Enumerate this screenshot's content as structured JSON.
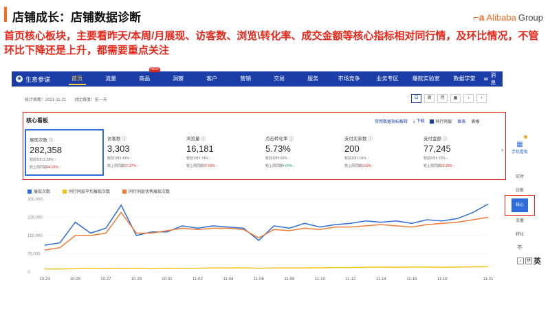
{
  "slide": {
    "title": "店铺成长：店铺数据诊断",
    "logo_mark": "⌐a",
    "logo_text": "Alibaba",
    "logo_group": "Group",
    "description": "首页核心板块，主要看昨天/本周/月展现、访客数、浏览\\转化率、成交金额等核心指标相对同行情，及环比情况，不管环比下降还是上升，都需要重点关注"
  },
  "nav": {
    "brand": "生意参谋",
    "items": [
      {
        "label": "首页",
        "active": true
      },
      {
        "label": "流量"
      },
      {
        "label": "商品",
        "badge": "NEW"
      },
      {
        "label": "洞察"
      },
      {
        "label": "客户"
      },
      {
        "label": "营销"
      },
      {
        "label": "交易"
      },
      {
        "label": "服务"
      },
      {
        "label": "市场竞争"
      },
      {
        "label": "业务专区"
      },
      {
        "label": "爆款实验室"
      },
      {
        "label": "数据学堂"
      }
    ],
    "message": "消息"
  },
  "stats": {
    "period_label": "统计周期：2021-11-21",
    "compare_label": "对比维度：前一天"
  },
  "range_buttons": [
    "日",
    "周",
    "月",
    "▦",
    "‹",
    "›"
  ],
  "core": {
    "title": "核心看板",
    "tool_explain": "常用数据指标解释",
    "tool_download": "下载",
    "tool_peer": "同行同层",
    "tool_chart": "图表",
    "tool_table": "表格",
    "metrics": [
      {
        "label": "展现次数",
        "value": "282,358",
        "day_label": "较前1日",
        "day_pct": "12.28%",
        "day_dir": "up",
        "week_label": "较上周同期",
        "week_pct": "44.03%",
        "week_dir": "up"
      },
      {
        "label": "访客数",
        "value": "3,303",
        "day_label": "较前1日",
        "day_pct": "3.41%",
        "day_dir": "up",
        "week_label": "较上周同期",
        "week_pct": "37.37%",
        "week_dir": "up"
      },
      {
        "label": "浏览量",
        "value": "16,181",
        "day_label": "较前1日",
        "day_pct": "5.74%",
        "day_dir": "up",
        "week_label": "较上周同期",
        "week_pct": "37.69%",
        "week_dir": "up"
      },
      {
        "label": "点击转化率",
        "value": "5.73%",
        "day_label": "较前1日",
        "day_pct": "5.82%",
        "day_dir": "down",
        "week_label": "较上周同期",
        "week_pct": "4.60%",
        "week_dir": "down"
      },
      {
        "label": "支付买家数",
        "value": "200",
        "day_label": "较前1日",
        "day_pct": "1.01%",
        "day_dir": "up",
        "week_label": "较上周同期",
        "week_pct": "3.63%",
        "week_dir": "up"
      },
      {
        "label": "支付金额",
        "value": "77,245",
        "day_label": "较前1日",
        "day_pct": "6.72%",
        "day_dir": "down",
        "week_label": "较上周同期",
        "week_pct": "19.29%",
        "week_dir": "up"
      }
    ]
  },
  "chart_data": {
    "type": "line",
    "x": [
      "10-23",
      "10-24",
      "10-25",
      "10-26",
      "10-27",
      "10-28",
      "10-29",
      "10-30",
      "10-31",
      "11-01",
      "11-02",
      "11-03",
      "11-04",
      "11-05",
      "11-06",
      "11-07",
      "11-08",
      "11-09",
      "11-10",
      "11-11",
      "11-12",
      "11-13",
      "11-14",
      "11-15",
      "11-16",
      "11-17",
      "11-18",
      "11-19",
      "11-20",
      "11-21"
    ],
    "xticks": [
      "10-23",
      "10-25",
      "10-27",
      "10-29",
      "10-31",
      "11-02",
      "11-04",
      "11-06",
      "11-08",
      "11-10",
      "11-12",
      "11-14",
      "11-16",
      "11-18",
      "11-21"
    ],
    "yticks": [
      "300,000",
      "225,000",
      "150,000",
      "75,000",
      "0"
    ],
    "ylim": [
      0,
      300000
    ],
    "series": [
      {
        "name": "展现次数",
        "color": "#2f6cdb",
        "values": [
          110000,
          120000,
          205000,
          160000,
          180000,
          275000,
          150000,
          165000,
          165000,
          190000,
          180000,
          190000,
          185000,
          180000,
          130000,
          190000,
          180000,
          200000,
          185000,
          195000,
          200000,
          210000,
          205000,
          210000,
          200000,
          215000,
          210000,
          220000,
          245000,
          280000
        ]
      },
      {
        "name": "同行同层平均展现次数",
        "color": "#f5c518",
        "values": [
          12000,
          12000,
          13000,
          14000,
          13000,
          15000,
          14000,
          13000,
          14000,
          15000,
          15000,
          16000,
          16000,
          17000,
          15000,
          16000,
          16000,
          16000,
          17000,
          18000,
          18000,
          19000,
          20000,
          19000,
          20000,
          20000,
          19000,
          20000,
          21000,
          22000
        ]
      },
      {
        "name": "同行同层优秀展现次数",
        "color": "#f07c37",
        "values": [
          90000,
          100000,
          150000,
          150000,
          160000,
          245000,
          160000,
          160000,
          170000,
          180000,
          175000,
          180000,
          180000,
          175000,
          140000,
          175000,
          170000,
          180000,
          175000,
          185000,
          185000,
          190000,
          195000,
          190000,
          185000,
          195000,
          200000,
          205000,
          215000,
          225000
        ]
      }
    ]
  },
  "side": {
    "mobile": "手机看板",
    "realtime": "实时",
    "diagnose": "诊断",
    "core": "核心",
    "traffic": "流量",
    "conversion": "转化",
    "no": "不"
  },
  "ime": {
    "icon": "♪",
    "pin": "拼",
    "zh": "英"
  }
}
